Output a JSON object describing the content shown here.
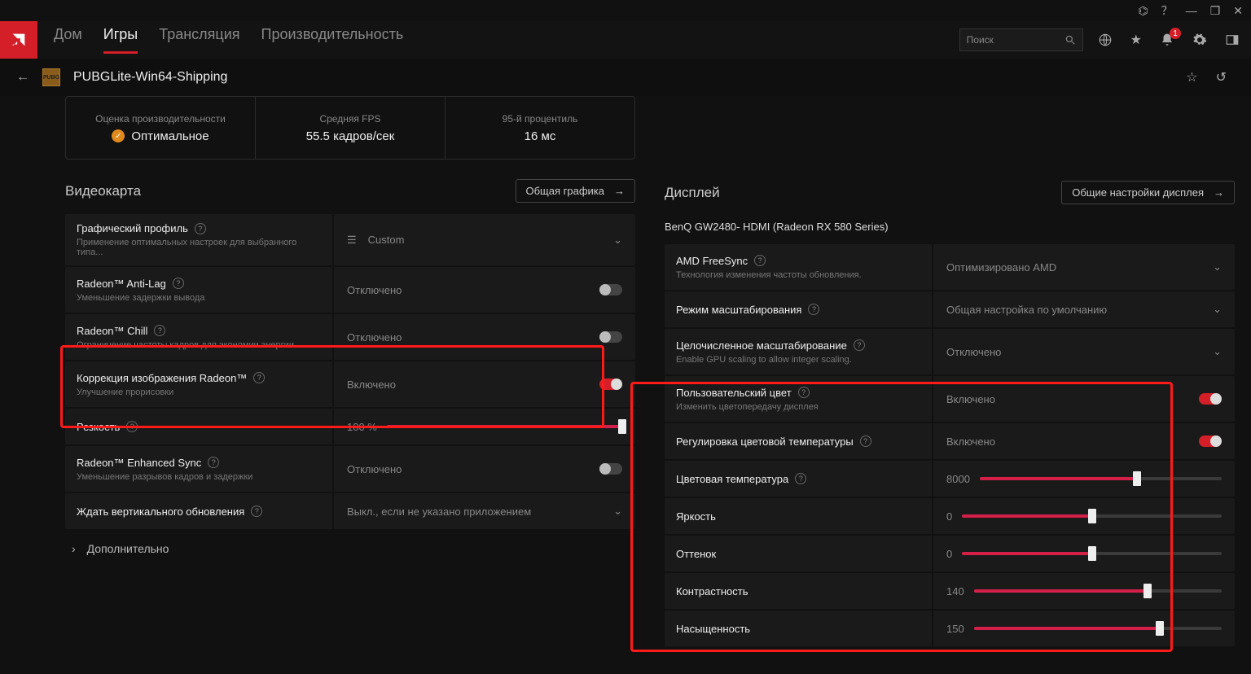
{
  "titlebar": {
    "badge": "1"
  },
  "nav": {
    "home": "Дом",
    "games": "Игры",
    "stream": "Трансляция",
    "perf": "Производительность"
  },
  "search": {
    "placeholder": "Поиск"
  },
  "game": {
    "name": "PUBGLite-Win64-Shipping"
  },
  "stats": {
    "perf_label": "Оценка производительности",
    "perf_value": "Оптимальное",
    "fps_label": "Средняя FPS",
    "fps_value": "55.5 кадров/сек",
    "p95_label": "95-й процентиль",
    "p95_value": "16 мс"
  },
  "left": {
    "section": "Видеокарта",
    "section_btn": "Общая графика",
    "profile": {
      "t": "Графический профиль",
      "s": "Применение оптимальных настроек для выбранного типа...",
      "v": "Custom"
    },
    "antilag": {
      "t": "Radeon™ Anti-Lag",
      "s": "Уменьшение задержки вывода",
      "v": "Отключено"
    },
    "chill": {
      "t": "Radeon™ Chill",
      "s": "Ограничение частоты кадров для экономии энергии",
      "v": "Отключено"
    },
    "sharp": {
      "t": "Коррекция изображения Radeon™",
      "s": "Улучшение прорисовки",
      "v": "Включено"
    },
    "sharpness": {
      "t": "Резкость",
      "v": "100 %"
    },
    "esync": {
      "t": "Radeon™ Enhanced Sync",
      "s": "Уменьшение разрывов кадров и задержки",
      "v": "Отключено"
    },
    "vsync": {
      "t": "Ждать вертикального обновления",
      "v": "Выкл., если не указано приложением"
    },
    "more": "Дополнительно"
  },
  "right": {
    "section": "Дисплей",
    "section_btn": "Общие настройки дисплея",
    "monitor": "BenQ GW2480- HDMI (Radeon RX 580 Series)",
    "freesync": {
      "t": "AMD FreeSync",
      "s": "Технология изменения частоты обновления.",
      "v": "Оптимизировано AMD"
    },
    "scaling": {
      "t": "Режим масштабирования",
      "v": "Общая настройка по умолчанию"
    },
    "intscale": {
      "t": "Целочисленное масштабирование",
      "s": "Enable GPU scaling to allow integer scaling.",
      "v": "Отключено"
    },
    "custcolor": {
      "t": "Пользовательский цвет",
      "s": "Изменить цветопередачу дисплея",
      "v": "Включено"
    },
    "tempadj": {
      "t": "Регулировка цветовой температуры",
      "v": "Включено"
    },
    "colortemp": {
      "t": "Цветовая температура",
      "v": "8000"
    },
    "brightness": {
      "t": "Яркость",
      "v": "0"
    },
    "hue": {
      "t": "Оттенок",
      "v": "0"
    },
    "contrast": {
      "t": "Контрастность",
      "v": "140"
    },
    "saturation": {
      "t": "Насыщенность",
      "v": "150"
    }
  }
}
